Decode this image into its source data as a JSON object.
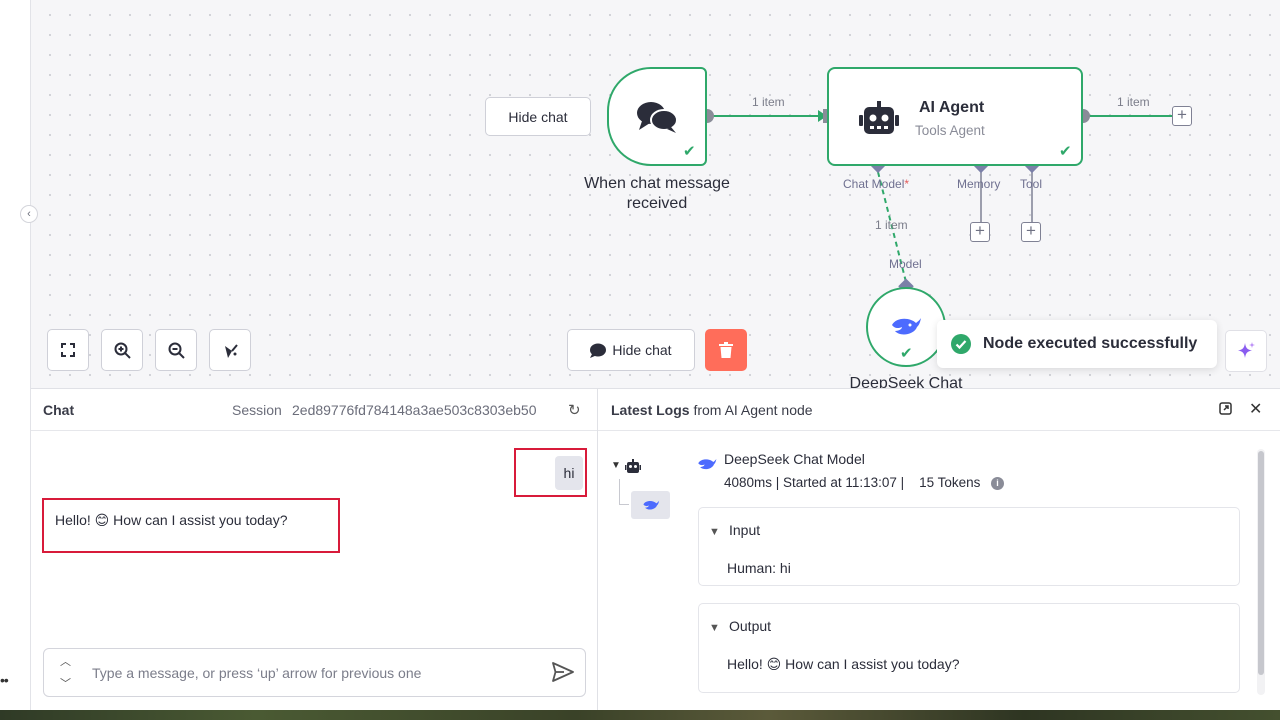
{
  "canvas": {
    "hide_chat_top": "Hide chat",
    "hide_chat_bottom": "Hide chat",
    "connections": {
      "trigger_to_agent": "1 item",
      "agent_output": "1 item",
      "model_link": "1 item"
    },
    "nodes": {
      "trigger": {
        "label_line1": "When chat message",
        "label_line2": "received",
        "icon": "chat-bubbles-icon"
      },
      "agent": {
        "title": "AI Agent",
        "subtitle": "Tools Agent",
        "icon": "robot-icon"
      },
      "deepseek": {
        "label": "DeepSeek Chat",
        "icon": "deepseek-whale-icon"
      }
    },
    "ports": {
      "chat_model": "Chat Model",
      "required_mark": "*",
      "memory": "Memory",
      "tool": "Tool",
      "model": "Model"
    },
    "toolbar": [
      "fit-view-icon",
      "zoom-in-icon",
      "zoom-out-icon",
      "tidy-up-icon"
    ],
    "toast": "Node executed successfully",
    "colors": {
      "success": "#2fa86a",
      "danger": "#ff6d5a",
      "accent": "#7b5cf0"
    }
  },
  "chat": {
    "title": "Chat",
    "session_label": "Session",
    "session_id": "2ed89776fd784148a3ae503c8303eb50",
    "messages": {
      "user": "hi",
      "bot": "Hello! 😊 How can I assist you today?"
    },
    "input_placeholder": "Type a message, or press ‘up’ arrow for previous one"
  },
  "logs": {
    "title_bold": "Latest Logs",
    "title_rest": " from AI Agent node",
    "entry_name": "DeepSeek Chat Model",
    "entry_meta": "4080ms | Started at 11:13:07 |    15 Tokens",
    "input_label": "Input",
    "input_body": "Human: hi",
    "output_label": "Output",
    "output_body": "Hello! 😊 How can I assist you today?"
  }
}
